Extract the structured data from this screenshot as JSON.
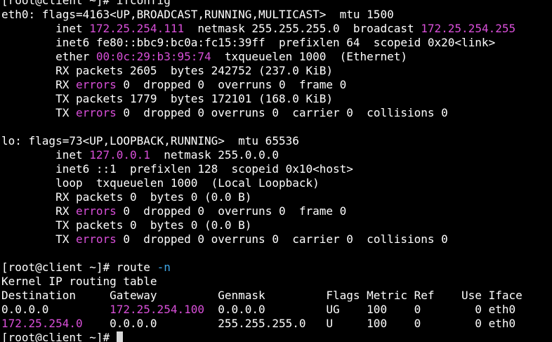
{
  "theme": {
    "background": "#000000",
    "foreground": "#ffffff",
    "highlight": "#d94fd9",
    "option": "#3fa7e8",
    "cursor": "#d8d8d8"
  },
  "lines": [
    [
      {
        "t": "[root@client ~]# ifconfig"
      }
    ],
    [
      {
        "t": "eth0: flags=4163<UP,BROADCAST,RUNNING,MULTICAST>  mtu 1500"
      }
    ],
    [
      {
        "t": "        inet "
      },
      {
        "t": "172.25.254.111",
        "c": "hl"
      },
      {
        "t": "  netmask 255.255.255.0  broadcast "
      },
      {
        "t": "172.25.254.255",
        "c": "hl"
      }
    ],
    [
      {
        "t": "        inet6 fe80::bbc9:bc0a:fc15:39ff  prefixlen 64  scopeid 0x20<link>"
      }
    ],
    [
      {
        "t": "        ether "
      },
      {
        "t": "00:0c:29:b3:95:74",
        "c": "hl"
      },
      {
        "t": "  txqueuelen 1000  (Ethernet)"
      }
    ],
    [
      {
        "t": "        RX packets 2605  bytes 242752 (237.0 KiB)"
      }
    ],
    [
      {
        "t": "        RX "
      },
      {
        "t": "errors",
        "c": "hl"
      },
      {
        "t": " 0  dropped 0  overruns 0  frame 0"
      }
    ],
    [
      {
        "t": "        TX packets 1779  bytes 172101 (168.0 KiB)"
      }
    ],
    [
      {
        "t": "        TX "
      },
      {
        "t": "errors",
        "c": "hl"
      },
      {
        "t": " 0  dropped 0 overruns 0  carrier 0  collisions 0"
      }
    ],
    [
      {
        "t": ""
      }
    ],
    [
      {
        "t": "lo: flags=73<UP,LOOPBACK,RUNNING>  mtu 65536"
      }
    ],
    [
      {
        "t": "        inet "
      },
      {
        "t": "127.0.0.1",
        "c": "hl"
      },
      {
        "t": "  netmask 255.0.0.0"
      }
    ],
    [
      {
        "t": "        inet6 ::1  prefixlen 128  scopeid 0x10<host>"
      }
    ],
    [
      {
        "t": "        loop  txqueuelen 1000  (Local Loopback)"
      }
    ],
    [
      {
        "t": "        RX packets 0  bytes 0 (0.0 B)"
      }
    ],
    [
      {
        "t": "        RX "
      },
      {
        "t": "errors",
        "c": "hl"
      },
      {
        "t": " 0  dropped 0  overruns 0  frame 0"
      }
    ],
    [
      {
        "t": "        TX packets 0  bytes 0 (0.0 B)"
      }
    ],
    [
      {
        "t": "        TX "
      },
      {
        "t": "errors",
        "c": "hl"
      },
      {
        "t": " 0  dropped 0 overruns 0  carrier 0  collisions 0"
      }
    ],
    [
      {
        "t": ""
      }
    ],
    [
      {
        "t": "[root@client ~]# route "
      },
      {
        "t": "-n",
        "c": "op"
      }
    ],
    [
      {
        "t": "Kernel IP routing table"
      }
    ],
    [
      {
        "t": "Destination     Gateway         Genmask         Flags Metric Ref    Use Iface"
      }
    ],
    [
      {
        "t": "0.0.0.0         "
      },
      {
        "t": "172.25.254.100",
        "c": "hl"
      },
      {
        "t": "  0.0.0.0         UG    100    0        0 eth0"
      }
    ],
    [
      {
        "t": "172.25.254.0",
        "c": "hl"
      },
      {
        "t": "    0.0.0.0         255.255.255.0   U     100    0        0 eth0"
      }
    ],
    [
      {
        "t": "[root@client ~]# "
      },
      {
        "cursor": true
      }
    ]
  ]
}
